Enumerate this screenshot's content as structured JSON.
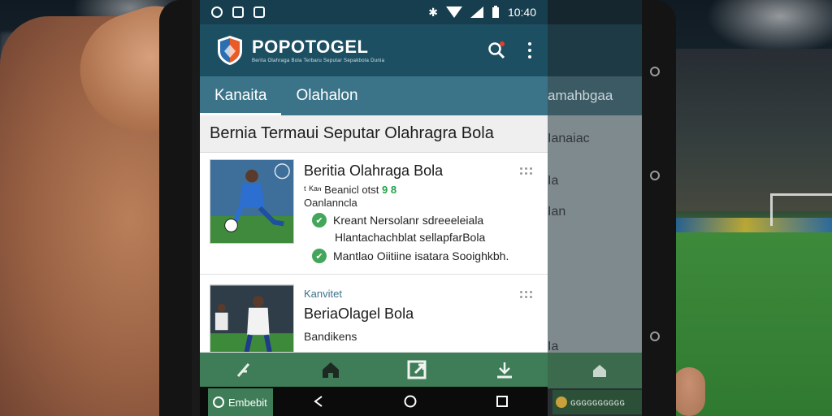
{
  "statusbar": {
    "time": "10:40"
  },
  "app": {
    "brand": "POPOTOGEL",
    "brand_sub": "Berita Olahraga Bola Terbaru Seputar Sepakbola Dunia"
  },
  "tabs": [
    {
      "label": "Kanaita"
    },
    {
      "label": "Olahalon"
    }
  ],
  "section_title": "Bernia Termaui Seputar Olahragra Bola",
  "cards": [
    {
      "title": "Beritia Olahraga Bola",
      "meta_prefix": "ᵗ ᴷᵃⁿ Beanicl otst",
      "meta_num": "9 8",
      "subtitle": "Oanlanncla",
      "lines": [
        {
          "text": "Kreant Nersolanr sdreeeleiala"
        },
        {
          "text": "Hlantachachblat sellapfarBola"
        },
        {
          "text": "Mantlao Oiitiine isatara Sooighkbh."
        }
      ]
    },
    {
      "category": "Kanvitet",
      "title": "BeriaOlagel Bola",
      "subtitle": "Bandikens"
    }
  ],
  "bottom_chip": "Embebit",
  "ghost": {
    "tab": "amahbgaa",
    "rows": [
      "Ianaiac",
      "Ia",
      "Ian",
      "Ia"
    ],
    "chip": "ɢɢɢɢɢɢɢɢɢɢ"
  },
  "colors": {
    "statusbar": "#163e4e",
    "appbar": "#1d4f62",
    "tabs": "#3b7388",
    "bottomnav": "#3e7d58",
    "accent_green": "#22a04a"
  }
}
